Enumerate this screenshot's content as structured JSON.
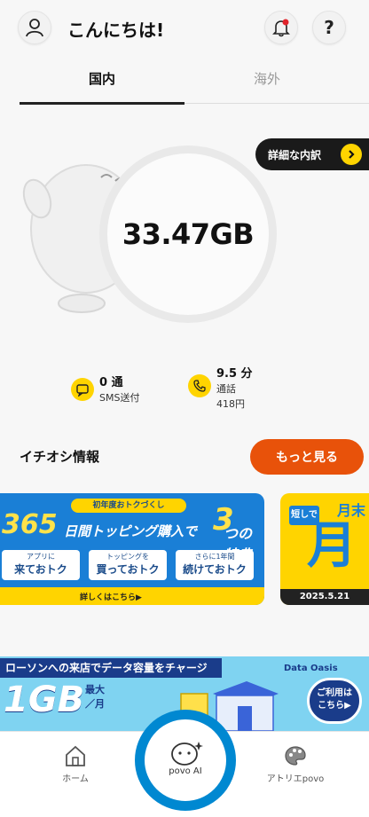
{
  "header": {
    "greeting": "こんにちは!",
    "help_label": "?"
  },
  "tabs": [
    {
      "label": "国内",
      "active": true
    },
    {
      "label": "海外",
      "active": false
    }
  ],
  "usage": {
    "detail_button": "詳細な内訳",
    "value": "33.47GB"
  },
  "stats": {
    "sms_count": "0 通",
    "sms_label": "SMS送付",
    "call_minutes": "9.5 分",
    "call_label": "通話",
    "call_price": "418円"
  },
  "recommend": {
    "title": "イチオシ情報",
    "more_button": "もっと見る"
  },
  "banner1": {
    "top": "初年度おトクづくし",
    "big": "365",
    "mid": "日間トッピング購入で",
    "three": "3",
    "tokuten": "つの特典",
    "boxes": [
      {
        "small": "アプリに",
        "main": "来ておトク"
      },
      {
        "small": "トッピングを",
        "main": "買っておトク"
      },
      {
        "small": "さらに1年間",
        "main": "続けておトク"
      }
    ],
    "link": "詳しくはこちら▶"
  },
  "banner2": {
    "tag": "短しで",
    "month": "月末",
    "big": "月",
    "date": "2025.5.21"
  },
  "banner3": {
    "head": "ローソンへの来店でデータ容量をチャージ",
    "gb": "1GB",
    "max_top": "最大",
    "max_bottom": "／月",
    "logo": "Data Oasis",
    "detail": "ご利用は\nこちら▶"
  },
  "nav": {
    "home": "ホーム",
    "ai": "povo AI",
    "atelier": "アトリエpovo"
  },
  "colors": {
    "accent_orange": "#e8520a",
    "accent_yellow": "#ffd400",
    "ai_ring_blue": "#0088d1"
  }
}
